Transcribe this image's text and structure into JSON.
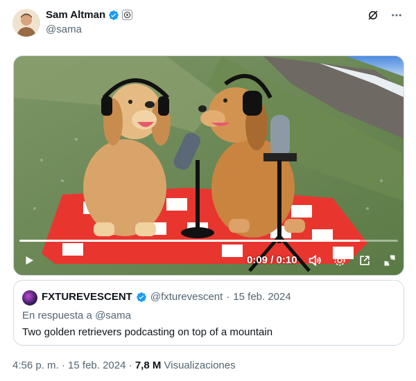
{
  "tweet": {
    "author": {
      "display_name": "Sam Altman",
      "handle": "@sama",
      "verified": true,
      "affiliation_badge_icon": "organization-badge-icon"
    },
    "header_actions": [
      {
        "name": "grok-icon"
      },
      {
        "name": "more-options-icon",
        "label": "···"
      }
    ],
    "video": {
      "current_time": "0:09",
      "duration": "0:10",
      "time_display": "0:09 / 0:10",
      "progress": 0.9,
      "controls": [
        "play-icon",
        "volume-icon",
        "settings-icon",
        "popout-icon",
        "fullscreen-icon"
      ]
    },
    "quoted": {
      "display_name": "FXTUREVESCENT",
      "handle": "@fxturevescent",
      "separator": "·",
      "date": "15 feb. 2024",
      "reply_to": "En respuesta a @sama",
      "text": "Two golden retrievers podcasting on top of a mountain"
    },
    "footer": {
      "time": "4:56 p. m.",
      "separator": "·",
      "date": "15 feb. 2024",
      "views_count": "7,8 M",
      "views_label": "Visualizaciones"
    }
  },
  "colors": {
    "verified_blue": "#1d9bf0",
    "secondary_text": "#536471",
    "primary_text": "#0f1419",
    "border": "#cfd9de"
  }
}
